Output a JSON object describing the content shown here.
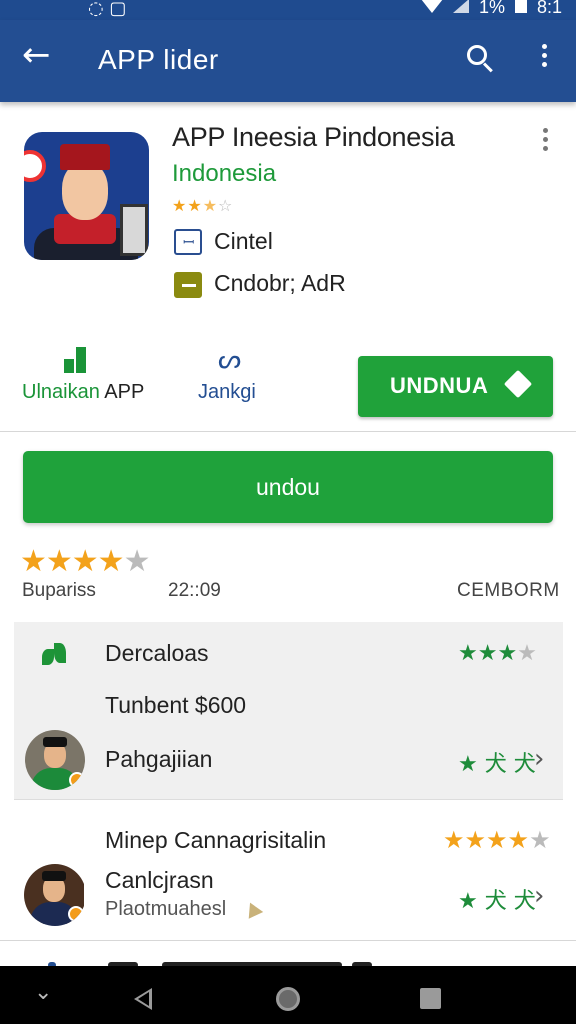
{
  "status_bar": {
    "left_icons": "◌ ▢",
    "battery_text": "1%",
    "time": "8:1"
  },
  "app_bar": {
    "title": "APP lider"
  },
  "app": {
    "title": "APP Ineesia Pindonesia",
    "developer": "Indonesia",
    "rating_stars": 2.5,
    "content_rating": "Cintel",
    "ads_label": "Cndobr; AdR"
  },
  "actions": {
    "uninstall_prefix": "Ulnaikan",
    "uninstall_suffix": "APP",
    "share_label": "Jankgi",
    "install_label": "UNDNUA"
  },
  "install_big_label": "undou",
  "rating_summary": {
    "stars": 4,
    "label": "Bupariss",
    "time": "22::09",
    "tag": "CEMBORM"
  },
  "reviews": [
    {
      "title": "Dercaloas",
      "stars": 3
    },
    {
      "subtitle": "Tunbent $600"
    },
    {
      "name": "Pahgajiian",
      "rating_display": "★ 犬 犬"
    },
    {
      "title": "Minep Cannagrisitalin",
      "stars": 4
    },
    {
      "name": "Canlcjrasn",
      "detail": "Plaotmuahesl",
      "rating_display": "★ 犬 犬"
    }
  ],
  "colors": {
    "app_bar": "#234e92",
    "accent_green": "#20a23a",
    "star_orange": "#f3a21b",
    "star_green": "#1e8c3a"
  }
}
